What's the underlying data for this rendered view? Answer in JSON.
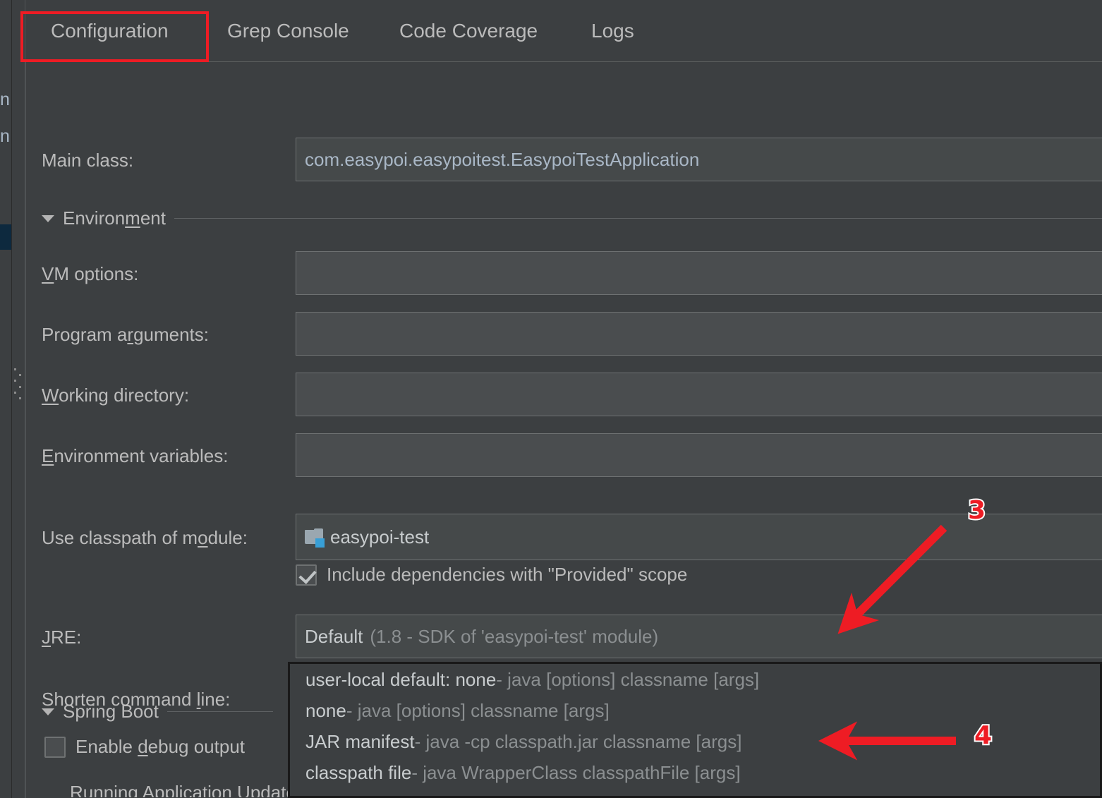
{
  "tabs": [
    {
      "label": "Configuration",
      "active": true
    },
    {
      "label": "Grep Console",
      "active": false
    },
    {
      "label": "Code Coverage",
      "active": false
    },
    {
      "label": "Logs",
      "active": false
    }
  ],
  "form": {
    "main_class": {
      "label": "Main class:",
      "value": "com.easypoi.easypoitest.EasypoiTestApplication"
    },
    "environment_section": {
      "label_pre": "Environ",
      "label_mn": "m",
      "label_post": "ent"
    },
    "vm_options": {
      "label_pre": "",
      "label_mn": "V",
      "label_post": "M options:",
      "value": ""
    },
    "program_arguments": {
      "label_pre": "Program a",
      "label_mn": "r",
      "label_post": "guments:",
      "value": ""
    },
    "working_directory": {
      "label_pre": "",
      "label_mn": "W",
      "label_post": "orking directory:",
      "value": ""
    },
    "environment_variables": {
      "label_pre": "",
      "label_mn": "E",
      "label_post": "nvironment variables:",
      "value": ""
    },
    "use_classpath_of_module": {
      "label_pre": "Use classpath of m",
      "label_mn": "o",
      "label_post": "dule:",
      "value": "easypoi-test",
      "icon": "module-folder-icon"
    },
    "include_provided_scope": {
      "label": "Include dependencies with \"Provided\" scope",
      "checked": true
    },
    "jre": {
      "label_pre": "",
      "label_mn": "J",
      "label_post": "RE:",
      "value_bright": "Default",
      "value_dim": "(1.8 - SDK of 'easypoi-test' module)"
    },
    "shorten_command_line": {
      "label_pre": "Shorten command ",
      "label_mn": "l",
      "label_post": "ine:",
      "value_bright": "user-local default: none",
      "value_dim": " - java [options] classname [args]",
      "focused": true,
      "expanded": true
    },
    "spring_boot_section": {
      "label_pre": "Spring Boot",
      "label_mn": "",
      "label_post": ""
    },
    "enable_debug_output": {
      "label_pre": "Enable ",
      "label_mn": "d",
      "label_post": "ebug output",
      "checked": false
    },
    "running_update_policies": {
      "label": "Running Application Update Policies"
    }
  },
  "dropdown": {
    "items": [
      {
        "bright": "user-local default: none",
        "dim": " - java [options] classname [args]"
      },
      {
        "bright": "none",
        "dim": " - java [options] classname [args]"
      },
      {
        "bright": "JAR manifest",
        "dim": " - java -cp classpath.jar classname [args]"
      },
      {
        "bright": "classpath file",
        "dim": " - java WrapperClass classpathFile [args]"
      }
    ]
  },
  "annotations": {
    "marker_3": "3",
    "marker_4": "4",
    "color": "#ee1c24"
  },
  "colors": {
    "background": "#3c3f41",
    "field_background": "#45494a",
    "field_border": "#6e7172",
    "text": "#bbbbbb",
    "value_text": "#a9b7c6",
    "dim_text": "#8b8f91",
    "accent_blue": "#4a88c7",
    "badge_blue": "#389fd6",
    "annotation_red": "#ee1c24"
  }
}
